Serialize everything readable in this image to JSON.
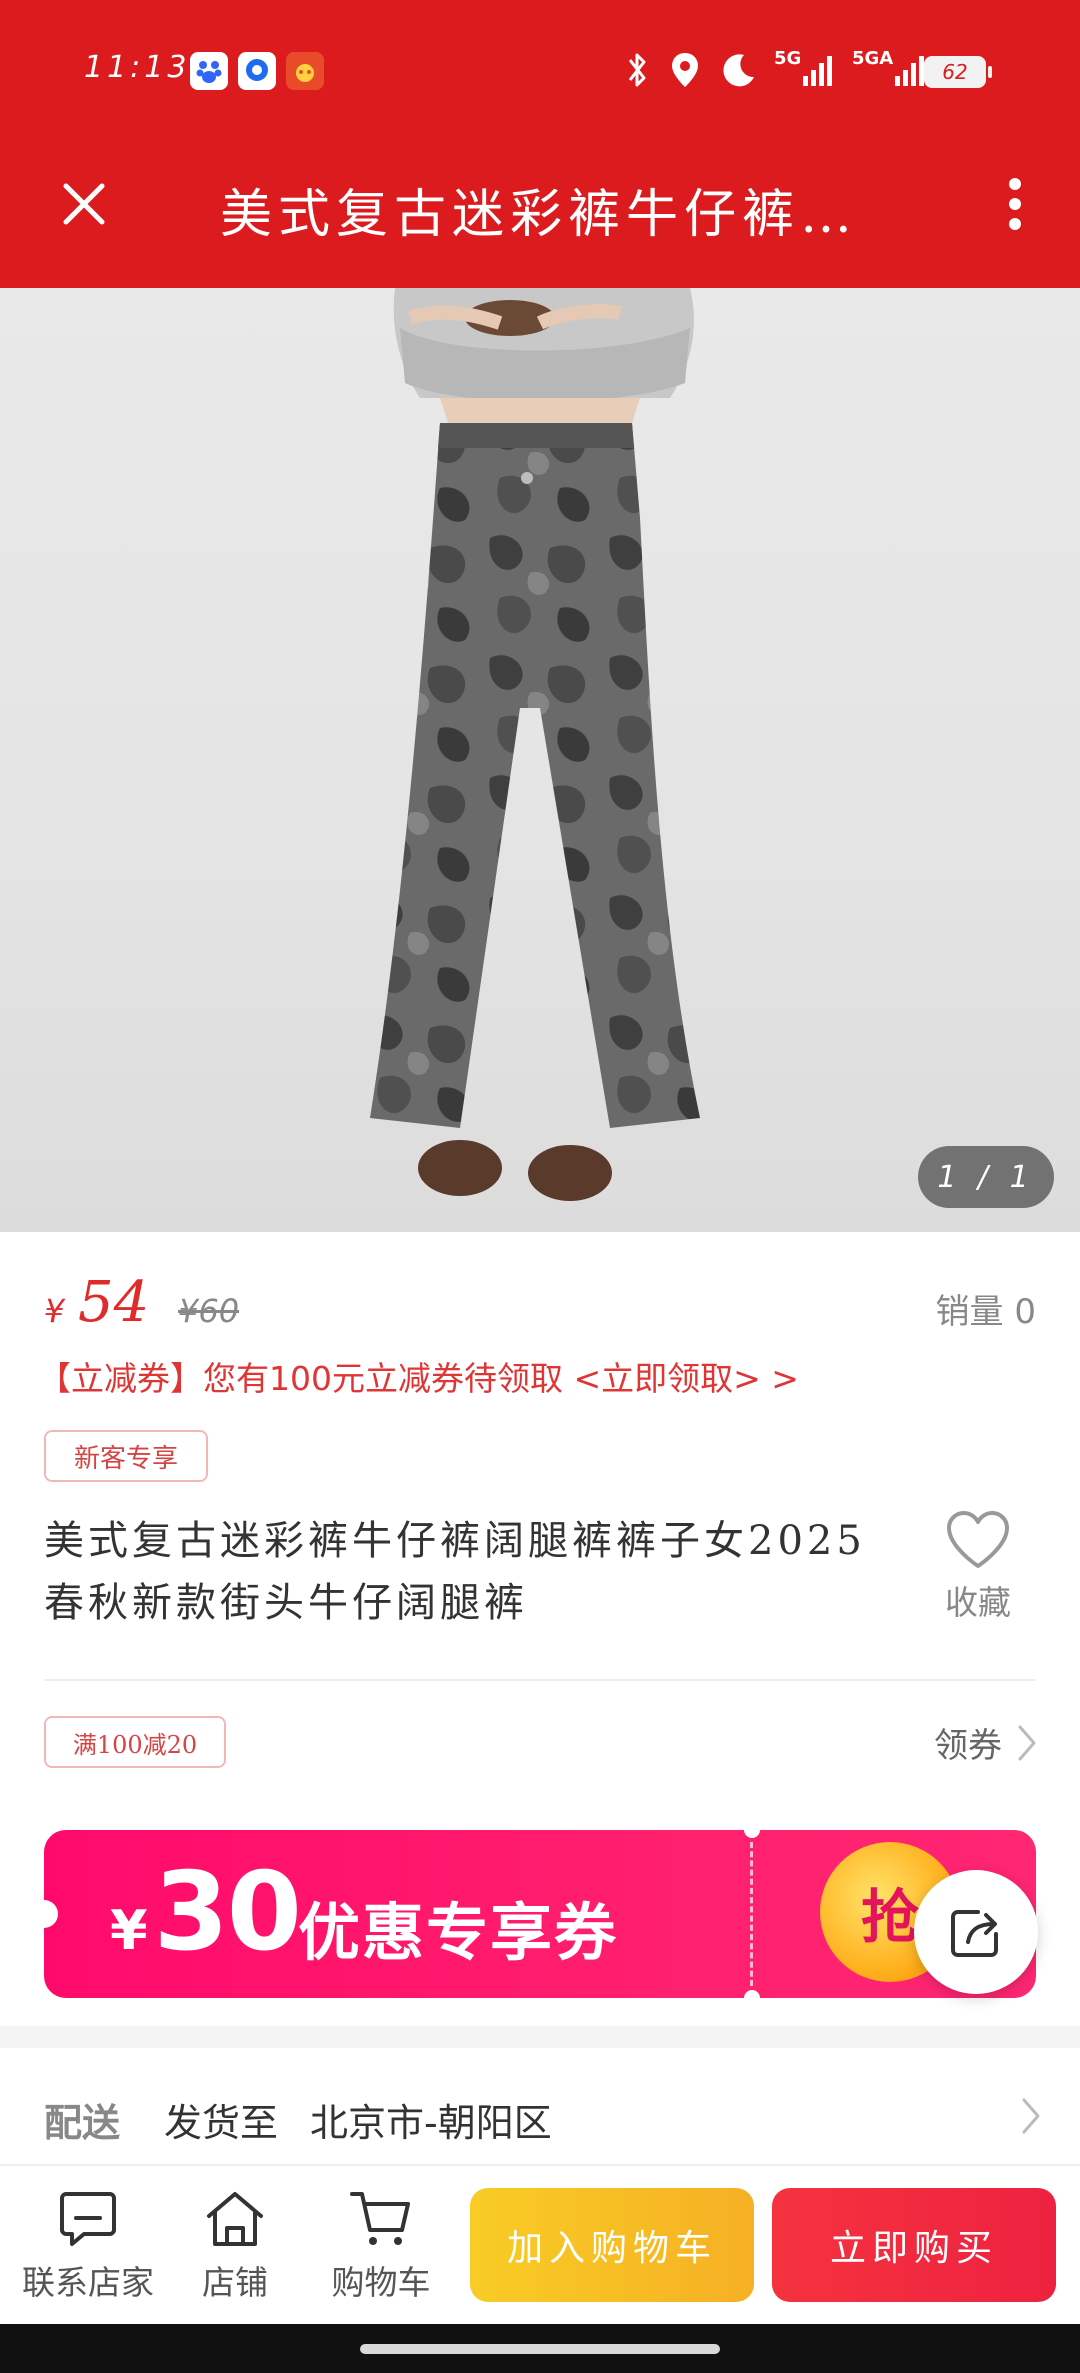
{
  "status_bar": {
    "time": "11:13",
    "net1": "5G",
    "net2": "5GA",
    "battery": "62"
  },
  "nav": {
    "title": "美式复古迷彩裤牛仔裤…"
  },
  "gallery": {
    "indicator": "1 / 1"
  },
  "price": {
    "symbol": "¥",
    "current": "54",
    "original": "¥60",
    "sales": "销量 0"
  },
  "coupon_hint": "【立减券】您有100元立减券待领取 <立即领取> >",
  "tags": {
    "new_user": "新客专享",
    "promo": "满100减20"
  },
  "product": {
    "title": "美式复古迷彩裤牛仔裤阔腿裤裤子女2025春秋新款街头牛仔阔腿裤",
    "favorite_label": "收藏"
  },
  "get_coupon_label": "领券",
  "banner": {
    "yen": "¥",
    "amount": "30",
    "text": "优惠专享券",
    "grab": "抢"
  },
  "delivery": {
    "label": "配送",
    "ship_to": "发货至",
    "address": "北京市-朝阳区"
  },
  "bottom_bar": {
    "contact": "联系店家",
    "shop": "店铺",
    "cart": "购物车",
    "add_to_cart": "加入购物车",
    "buy_now": "立即购买"
  },
  "colors": {
    "header_red": "#dc1b1f",
    "price_red": "#e02b2b",
    "banner_pink": "#ff0a6c",
    "cart_yellow": "#f8cc25",
    "buy_red": "#f5323e"
  }
}
